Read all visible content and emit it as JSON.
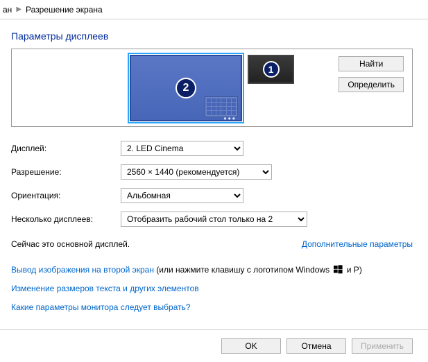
{
  "breadcrumb": {
    "prev": "ан",
    "current": "Разрешение экрана"
  },
  "heading": "Параметры дисплеев",
  "buttons": {
    "find": "Найти",
    "identify": "Определить"
  },
  "monitors": {
    "n1": "1",
    "n2": "2"
  },
  "labels": {
    "display": "Дисплей:",
    "resolution": "Разрешение:",
    "orientation": "Ориентация:",
    "multiple": "Несколько дисплеев:"
  },
  "values": {
    "display": "2. LED Cinema",
    "resolution": "2560 × 1440 (рекомендуется)",
    "orientation": "Альбомная",
    "multiple": "Отобразить рабочий стол только на 2"
  },
  "status": "Сейчас это основной дисплей.",
  "links": {
    "advanced": "Дополнительные параметры",
    "project_prefix": "Вывод изображения на второй экран",
    "project_suffix_a": " (или нажмите клавишу с логотипом Windows ",
    "project_suffix_b": " и P)",
    "textsize": "Изменение размеров текста и других элементов",
    "which": "Какие параметры монитора следует выбрать?"
  },
  "footer": {
    "ok": "OK",
    "cancel": "Отмена",
    "apply": "Применить"
  }
}
